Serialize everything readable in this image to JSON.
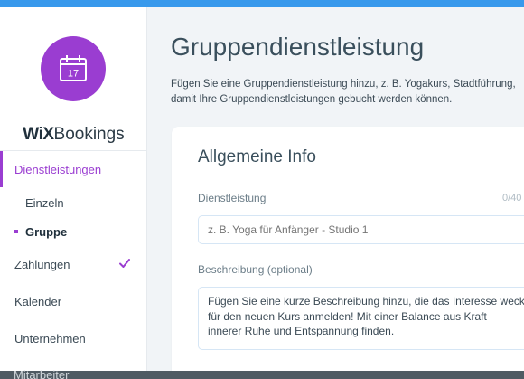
{
  "colors": {
    "accent": "#9a3dd1",
    "topbar": "#3899ec",
    "title": "#3a4f5c"
  },
  "brand": {
    "wix": "WiX",
    "product": "Bookings",
    "calendar_day": "17",
    "icon": "calendar-icon"
  },
  "sidebar": {
    "active_item": "Dienstleistungen",
    "sub_items": [
      {
        "label": "Einzeln"
      },
      {
        "label": "Gruppe"
      }
    ],
    "items": [
      {
        "label": "Zahlungen",
        "completed_icon": "check-icon"
      },
      {
        "label": "Kalender"
      },
      {
        "label": "Unternehmen"
      },
      {
        "label": "Mitarbeiter"
      }
    ]
  },
  "main": {
    "title": "Gruppendienstleistung",
    "description_line1": "Fügen Sie eine Gruppendienstleistung hinzu, z. B. Yogakurs, Stadtführung,",
    "description_line2": "damit Ihre Gruppendienstleistungen gebucht werden können."
  },
  "card": {
    "title": "Allgemeine Info",
    "service_label": "Dienstleistung",
    "service_counter": "0/40",
    "service_placeholder": "z. B. Yoga für Anfänger - Studio 1",
    "description_label": "Beschreibung (optional)",
    "description_line1": "Fügen Sie eine kurze Beschreibung hinzu, die das Interesse weckt,",
    "description_line2": "für den neuen Kurs anmelden! Mit einer Balance aus Kraft",
    "description_line3": "innerer Ruhe und Entspannung finden."
  }
}
